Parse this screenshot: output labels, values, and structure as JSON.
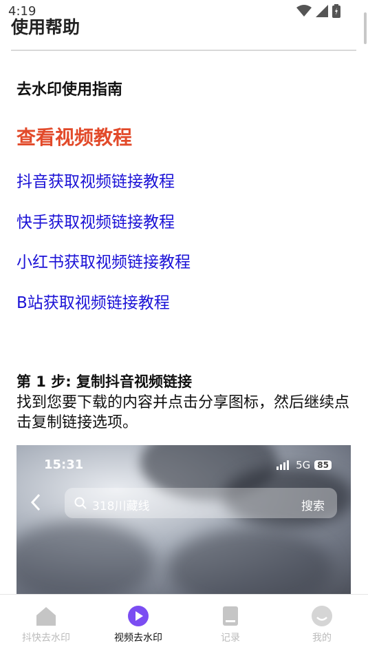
{
  "status_bar": {
    "time": "4:19"
  },
  "page": {
    "title": "使用帮助"
  },
  "guide": {
    "heading": "去水印使用指南",
    "video_tutorial": "查看视频教程",
    "links": [
      "抖音获取视频链接教程",
      "快手获取视频链接教程",
      "小红书获取视频链接教程",
      "B站获取视频链接教程"
    ]
  },
  "step1": {
    "title": "第 1 步: 复制抖音视频链接",
    "description": "找到您要下载的内容并点击分享图标，然后继续点击复制链接选项。"
  },
  "screenshot": {
    "time": "15:31",
    "network": "5G",
    "battery": "85",
    "search_text": "318川藏线",
    "search_button": "搜索"
  },
  "bottom_nav": {
    "items": [
      {
        "label": "抖快去水印",
        "icon": "home-icon",
        "active": false
      },
      {
        "label": "视频去水印",
        "icon": "play-icon",
        "active": true
      },
      {
        "label": "记录",
        "icon": "document-icon",
        "active": false
      },
      {
        "label": "我的",
        "icon": "profile-icon",
        "active": false
      }
    ]
  },
  "colors": {
    "video_link": "#e24a2a",
    "tutorial_link": "#1b12d6",
    "nav_active": "#7b4df2",
    "nav_inactive": "#c5c5c5"
  }
}
